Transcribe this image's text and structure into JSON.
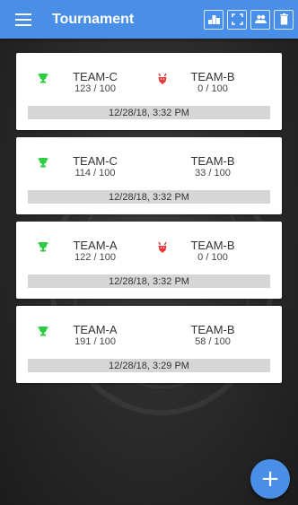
{
  "appbar": {
    "title": "Tournament",
    "actions": [
      {
        "icon": "leaderboard-icon"
      },
      {
        "icon": "fullscreen-icon"
      },
      {
        "icon": "players-icon"
      },
      {
        "icon": "delete-icon"
      }
    ]
  },
  "colors": {
    "primary": "#4a8fe7",
    "winner": "#2ecc40",
    "loser": "#e53935",
    "date_bar": "#d6d6d6"
  },
  "matches": [
    {
      "left_team": "TEAM-C",
      "left_score": "123 / 100",
      "left_icon": "trophy-icon",
      "right_team": "TEAM-B",
      "right_score": "0 / 100",
      "right_icon": "devil-icon",
      "date": "12/28/18, 3:32 PM"
    },
    {
      "left_team": "TEAM-C",
      "left_score": "114 / 100",
      "left_icon": "trophy-icon",
      "right_team": "TEAM-B",
      "right_score": "33 / 100",
      "right_icon": "",
      "date": "12/28/18, 3:32 PM"
    },
    {
      "left_team": "TEAM-A",
      "left_score": "122 / 100",
      "left_icon": "trophy-icon",
      "right_team": "TEAM-B",
      "right_score": "0 / 100",
      "right_icon": "devil-icon",
      "date": "12/28/18, 3:32 PM"
    },
    {
      "left_team": "TEAM-A",
      "left_score": "191 / 100",
      "left_icon": "trophy-icon",
      "right_team": "TEAM-B",
      "right_score": "58 / 100",
      "right_icon": "",
      "date": "12/28/18, 3:29 PM"
    }
  ],
  "fab": {
    "label": "+"
  }
}
